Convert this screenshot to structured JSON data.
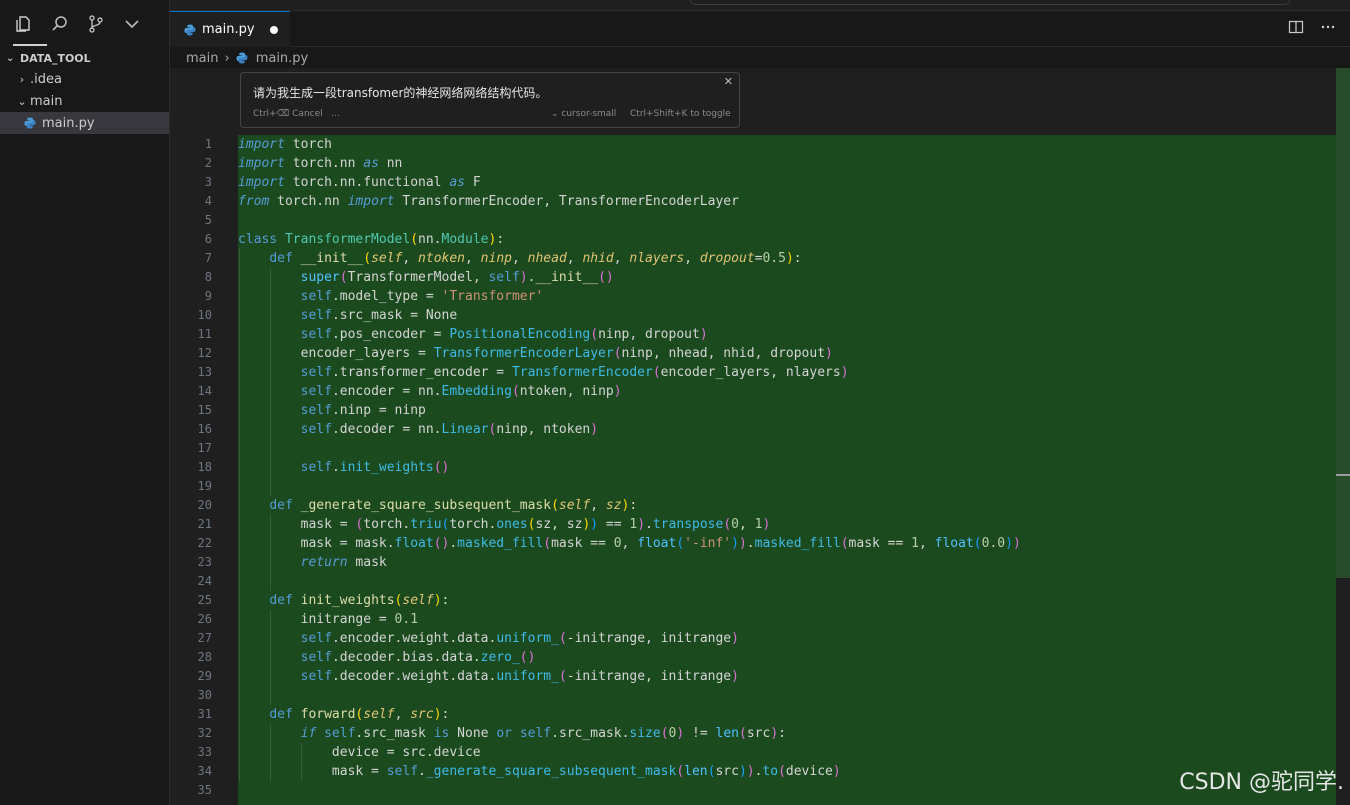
{
  "sidebar": {
    "section_title": "DATA_TOOL",
    "items": [
      {
        "label": ".idea",
        "chevron": "›"
      },
      {
        "label": "main",
        "chevron": "⌄"
      },
      {
        "label": "main.py"
      }
    ]
  },
  "tab": {
    "label": "main.py"
  },
  "breadcrumb": {
    "folder": "main",
    "sep": "›",
    "file": "main.py"
  },
  "prompt": {
    "text": "请为我生成一段transfomer的神经网络网络结构代码。",
    "cancel": "Ctrl+⌫ Cancel",
    "ellipsis": "...",
    "model": "⌄ cursor-small",
    "toggle": "Ctrl+Shift+K to toggle",
    "close": "✕"
  },
  "line_numbers": [
    "1",
    "2",
    "3",
    "4",
    "5",
    "6",
    "7",
    "8",
    "9",
    "10",
    "11",
    "12",
    "13",
    "14",
    "15",
    "16",
    "17",
    "18",
    "19",
    "20",
    "21",
    "22",
    "23",
    "24",
    "25",
    "26",
    "27",
    "28",
    "29",
    "30",
    "31",
    "32",
    "33",
    "34",
    "35"
  ],
  "watermark": "CSDN @驼同学."
}
